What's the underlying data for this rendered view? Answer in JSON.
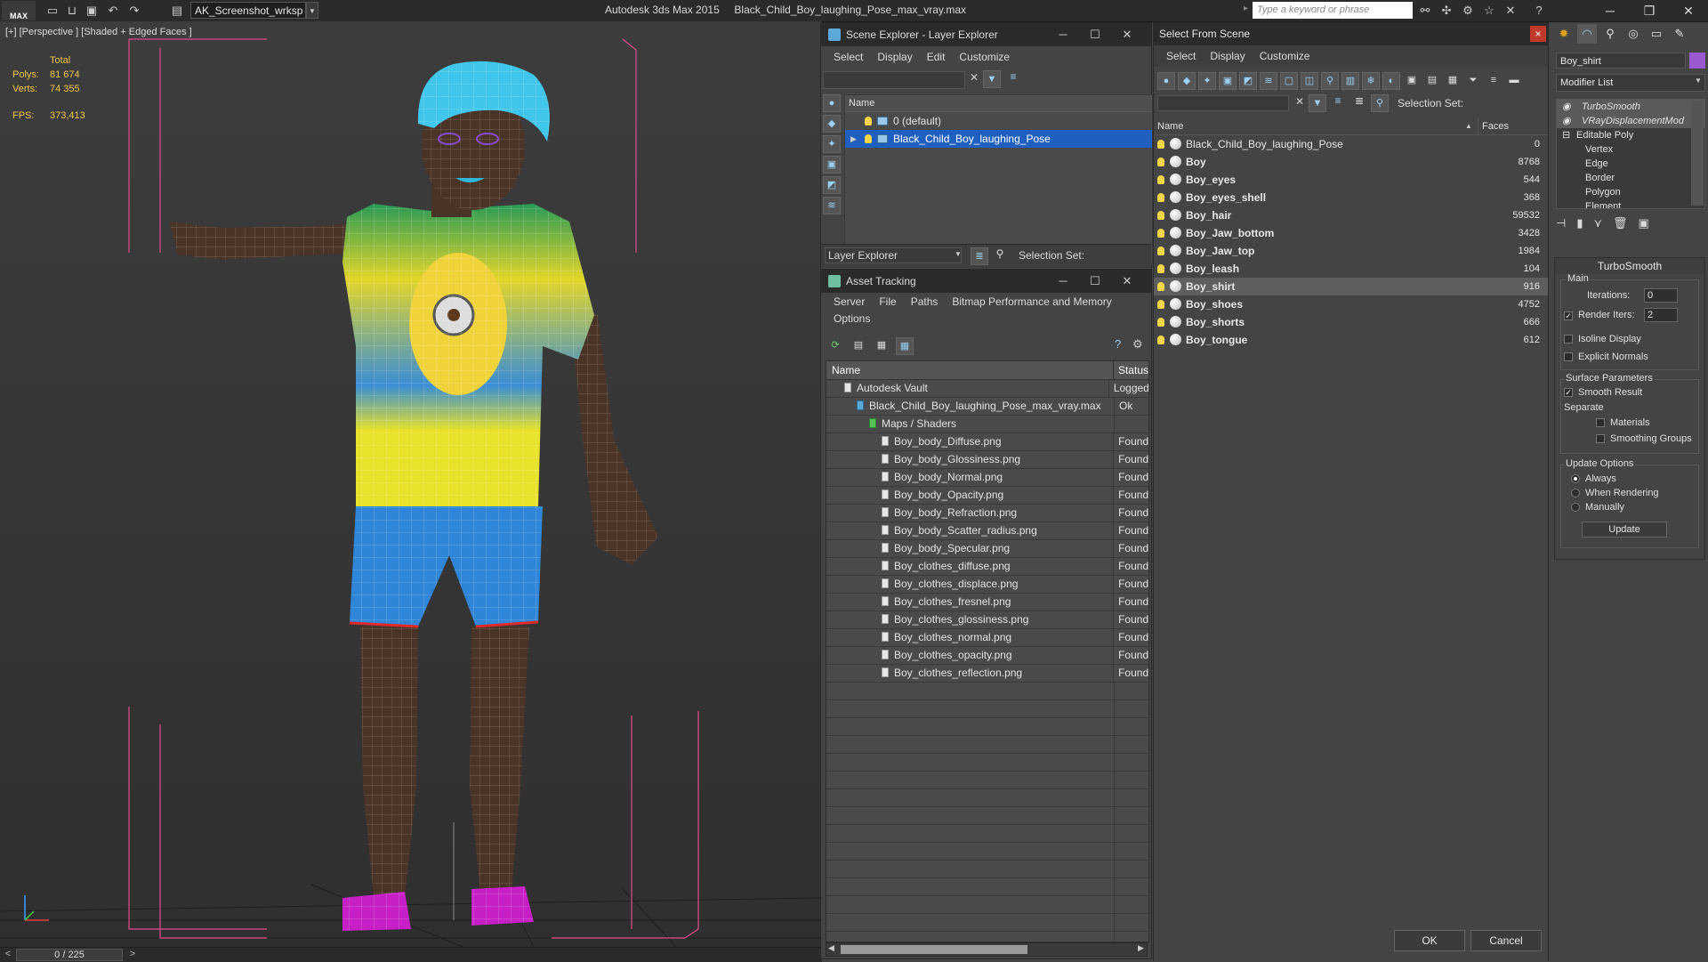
{
  "titlebar": {
    "app_logo": "MAX",
    "workspace": "AK_Screenshot_wrksp",
    "app_title": "Autodesk 3ds Max  2015",
    "file_title": "Black_Child_Boy_laughing_Pose_max_vray.max",
    "search_placeholder": "Type a keyword or phrase"
  },
  "viewport": {
    "label": "[+] [Perspective ] [Shaded + Edged Faces ]",
    "stats": {
      "total_label": "Total",
      "polys_label": "Polys:",
      "polys_value": "81 674",
      "verts_label": "Verts:",
      "verts_value": "74 355",
      "fps_label": "FPS:",
      "fps_value": "373,413"
    }
  },
  "timeline": {
    "value": "0 / 225",
    "prev": "<",
    "next": ">"
  },
  "scene_explorer": {
    "title": "Scene Explorer - Layer Explorer",
    "menu": [
      "Select",
      "Display",
      "Edit",
      "Customize"
    ],
    "column_name": "Name",
    "rows": [
      {
        "label": "0 (default)",
        "selected": false
      },
      {
        "label": "Black_Child_Boy_laughing_Pose",
        "selected": true
      }
    ],
    "bottom_dropdown": "Layer Explorer",
    "selection_set_label": "Selection Set:"
  },
  "asset_tracking": {
    "title": "Asset Tracking",
    "menu": [
      "Server",
      "File",
      "Paths",
      "Bitmap Performance and Memory"
    ],
    "menu_row2": [
      "Options"
    ],
    "columns": [
      "Name",
      "Status"
    ],
    "rows": [
      {
        "name": "Autodesk Vault",
        "status": "Logged",
        "indent": 1
      },
      {
        "name": "Black_Child_Boy_laughing_Pose_max_vray.max",
        "status": "Ok",
        "indent": 2
      },
      {
        "name": "Maps / Shaders",
        "status": "",
        "indent": 3
      },
      {
        "name": "Boy_body_Diffuse.png",
        "status": "Found",
        "indent": 4
      },
      {
        "name": "Boy_body_Glossiness.png",
        "status": "Found",
        "indent": 4
      },
      {
        "name": "Boy_body_Normal.png",
        "status": "Found",
        "indent": 4
      },
      {
        "name": "Boy_body_Opacity.png",
        "status": "Found",
        "indent": 4
      },
      {
        "name": "Boy_body_Refraction.png",
        "status": "Found",
        "indent": 4
      },
      {
        "name": "Boy_body_Scatter_radius.png",
        "status": "Found",
        "indent": 4
      },
      {
        "name": "Boy_body_Specular.png",
        "status": "Found",
        "indent": 4
      },
      {
        "name": "Boy_clothes_diffuse.png",
        "status": "Found",
        "indent": 4
      },
      {
        "name": "Boy_clothes_displace.png",
        "status": "Found",
        "indent": 4
      },
      {
        "name": "Boy_clothes_fresnel.png",
        "status": "Found",
        "indent": 4
      },
      {
        "name": "Boy_clothes_glossiness.png",
        "status": "Found",
        "indent": 4
      },
      {
        "name": "Boy_clothes_normal.png",
        "status": "Found",
        "indent": 4
      },
      {
        "name": "Boy_clothes_opacity.png",
        "status": "Found",
        "indent": 4
      },
      {
        "name": "Boy_clothes_reflection.png",
        "status": "Found",
        "indent": 4
      }
    ]
  },
  "select_from_scene": {
    "title": "Select From Scene",
    "close": "×",
    "menu": [
      "Select",
      "Display",
      "Customize"
    ],
    "selection_set_label": "Selection Set:",
    "columns": [
      "Name",
      "Faces"
    ],
    "rows": [
      {
        "name": "Black_Child_Boy_laughing_Pose",
        "faces": "0",
        "bold": false,
        "selected": false
      },
      {
        "name": "Boy",
        "faces": "8768",
        "bold": true,
        "selected": false
      },
      {
        "name": "Boy_eyes",
        "faces": "544",
        "bold": true,
        "selected": false
      },
      {
        "name": "Boy_eyes_shell",
        "faces": "368",
        "bold": true,
        "selected": false
      },
      {
        "name": "Boy_hair",
        "faces": "59532",
        "bold": true,
        "selected": false
      },
      {
        "name": "Boy_Jaw_bottom",
        "faces": "3428",
        "bold": true,
        "selected": false
      },
      {
        "name": "Boy_Jaw_top",
        "faces": "1984",
        "bold": true,
        "selected": false
      },
      {
        "name": "Boy_leash",
        "faces": "104",
        "bold": true,
        "selected": false
      },
      {
        "name": "Boy_shirt",
        "faces": "916",
        "bold": true,
        "selected": true
      },
      {
        "name": "Boy_shoes",
        "faces": "4752",
        "bold": true,
        "selected": false
      },
      {
        "name": "Boy_shorts",
        "faces": "666",
        "bold": true,
        "selected": false
      },
      {
        "name": "Boy_tongue",
        "faces": "612",
        "bold": true,
        "selected": false
      }
    ],
    "ok_label": "OK",
    "cancel_label": "Cancel"
  },
  "command_panel": {
    "object_name": "Boy_shirt",
    "object_color": "#9b59d0",
    "modifier_list_label": "Modifier List",
    "stack": [
      {
        "label": "TurboSmooth",
        "type": "mod"
      },
      {
        "label": "VRayDisplacementMod",
        "type": "mod"
      },
      {
        "label": "Editable Poly",
        "type": "base"
      },
      {
        "label": "Vertex",
        "type": "sub"
      },
      {
        "label": "Edge",
        "type": "sub"
      },
      {
        "label": "Border",
        "type": "sub"
      },
      {
        "label": "Polygon",
        "type": "sub"
      },
      {
        "label": "Element",
        "type": "sub"
      }
    ],
    "rollout_title": "TurboSmooth",
    "main_group": "Main",
    "iterations_label": "Iterations:",
    "iterations_value": "0",
    "render_iters_label": "Render Iters:",
    "render_iters_value": "2",
    "render_iters_checked": true,
    "isoline_label": "Isoline Display",
    "explicit_normals_label": "Explicit Normals",
    "surface_group": "Surface Parameters",
    "smooth_result_label": "Smooth Result",
    "separate_label": "Separate",
    "materials_label": "Materials",
    "smoothing_groups_label": "Smoothing Groups",
    "update_group": "Update Options",
    "always_label": "Always",
    "when_rendering_label": "When Rendering",
    "manually_label": "Manually",
    "update_button": "Update"
  },
  "colors": {
    "accent_selection": "#1f5fbf",
    "stats_text": "#f2c84a",
    "hair": "#3fc6ea",
    "shirt_yellow": "#e8e22a",
    "shorts_blue": "#2f86d8",
    "shoes_magenta": "#d020d0",
    "skin": "#4a3327"
  }
}
